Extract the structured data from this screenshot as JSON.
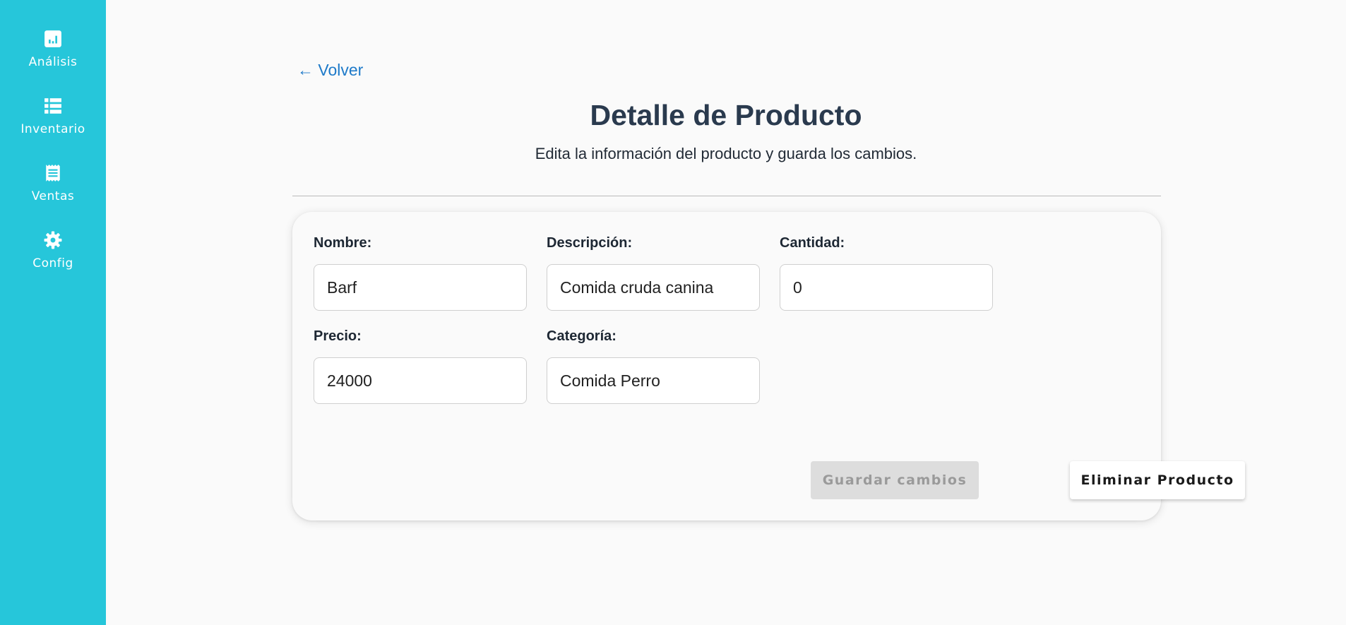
{
  "sidebar": {
    "items": [
      {
        "label": "Análisis",
        "icon": "analytics-icon"
      },
      {
        "label": "Inventario",
        "icon": "inventory-list-icon"
      },
      {
        "label": "Ventas",
        "icon": "receipt-icon"
      },
      {
        "label": "Config",
        "icon": "gear-icon"
      }
    ]
  },
  "header": {
    "back_label": "← Volver",
    "title": "Detalle de Producto",
    "subtitle": "Edita la información del producto y guarda los cambios."
  },
  "form": {
    "nombre": {
      "label": "Nombre:",
      "value": "Barf"
    },
    "descripcion": {
      "label": "Descripción:",
      "value": "Comida cruda canina"
    },
    "cantidad": {
      "label": "Cantidad:",
      "value": "0"
    },
    "precio": {
      "label": "Precio:",
      "value": "24000"
    },
    "categoria": {
      "label": "Categoría:",
      "value": "Comida Perro"
    }
  },
  "actions": {
    "save_label": "Guardar cambios",
    "delete_label": "Eliminar Producto"
  },
  "colors": {
    "sidebar": "#26c6da",
    "accent_link": "#1e7ac9",
    "title": "#2a3a4e",
    "disabled_button": "#dddddd"
  }
}
